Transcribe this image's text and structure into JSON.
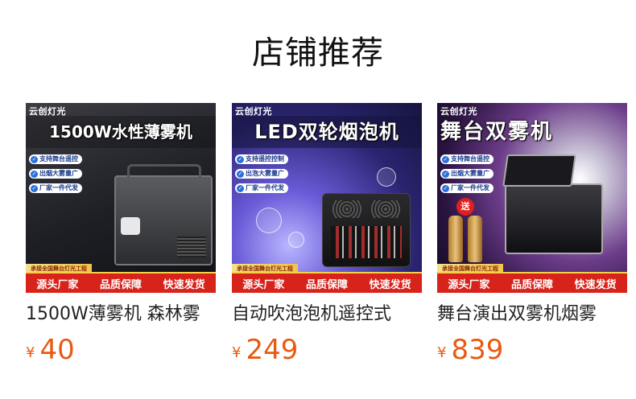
{
  "section_title": "店铺推荐",
  "products": [
    {
      "brand": "云创灯光",
      "headline": "1500W水性薄雾机",
      "features": [
        "支持舞台遥控",
        "出烟大雾量广",
        "厂家一件代发"
      ],
      "promo": "承接全国舞台灯光工程",
      "badges": [
        "源头厂家",
        "品质保障",
        "快速发货"
      ],
      "title": "1500W薄雾机 森林雾",
      "currency": "¥",
      "price": "40"
    },
    {
      "brand": "云创灯光",
      "headline": "LED双轮烟泡机",
      "features": [
        "支持遥控控制",
        "出泡大雾量广",
        "厂家一件代发"
      ],
      "promo": "承接全国舞台灯光工程",
      "badges": [
        "源头厂家",
        "品质保障",
        "快速发货"
      ],
      "title": "自动吹泡泡机遥控式",
      "currency": "¥",
      "price": "249"
    },
    {
      "brand": "云创灯光",
      "headline": "舞台双雾机",
      "features": [
        "支持舞台遥控",
        "出烟大雾量广",
        "厂家一件代发"
      ],
      "gift": "送",
      "promo": "承接全国舞台灯光工程",
      "badges": [
        "源头厂家",
        "品质保障",
        "快速发货"
      ],
      "title": "舞台演出双雾机烟雾",
      "currency": "¥",
      "price": "839"
    }
  ]
}
